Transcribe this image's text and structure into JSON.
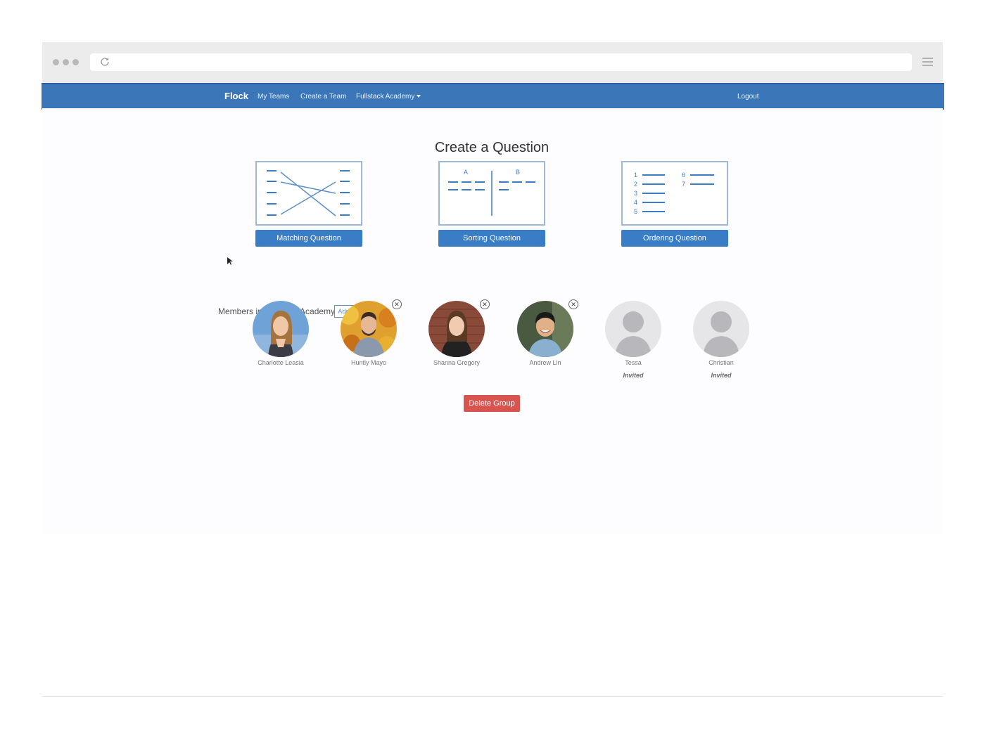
{
  "navbar": {
    "brand": "Flock",
    "links": [
      "My Teams",
      "Create a Team",
      "Fullstack Academy"
    ],
    "logout": "Logout"
  },
  "page": {
    "title": "Create a Question"
  },
  "question_types": [
    {
      "label": "Matching Question",
      "icon": "matching-diagram-icon"
    },
    {
      "label": "Sorting Question",
      "icon": "sorting-diagram-icon",
      "columns": [
        "A",
        "B"
      ]
    },
    {
      "label": "Ordering Question",
      "icon": "ordering-diagram-icon",
      "numbers": [
        "1",
        "2",
        "3",
        "4",
        "5",
        "6",
        "7"
      ]
    }
  ],
  "members_section": {
    "label": "Members in Fullstack Academy",
    "add_button": "Add+"
  },
  "members": [
    {
      "name": "Charlotte Leasia",
      "status": "",
      "removable": false,
      "avatar": "photo"
    },
    {
      "name": "Huntly Mayo",
      "status": "",
      "removable": true,
      "avatar": "photo"
    },
    {
      "name": "Shanna Gregory",
      "status": "",
      "removable": true,
      "avatar": "photo"
    },
    {
      "name": "Andrew Lin",
      "status": "",
      "removable": true,
      "avatar": "photo"
    },
    {
      "name": "Tessa",
      "status": "Invited",
      "removable": false,
      "avatar": "placeholder"
    },
    {
      "name": "Christian",
      "status": "Invited",
      "removable": false,
      "avatar": "placeholder"
    }
  ],
  "delete_button": "Delete Group",
  "colors": {
    "navbar": "#3a76b8",
    "primary_button": "#3a7dc7",
    "danger_button": "#d9534f"
  }
}
